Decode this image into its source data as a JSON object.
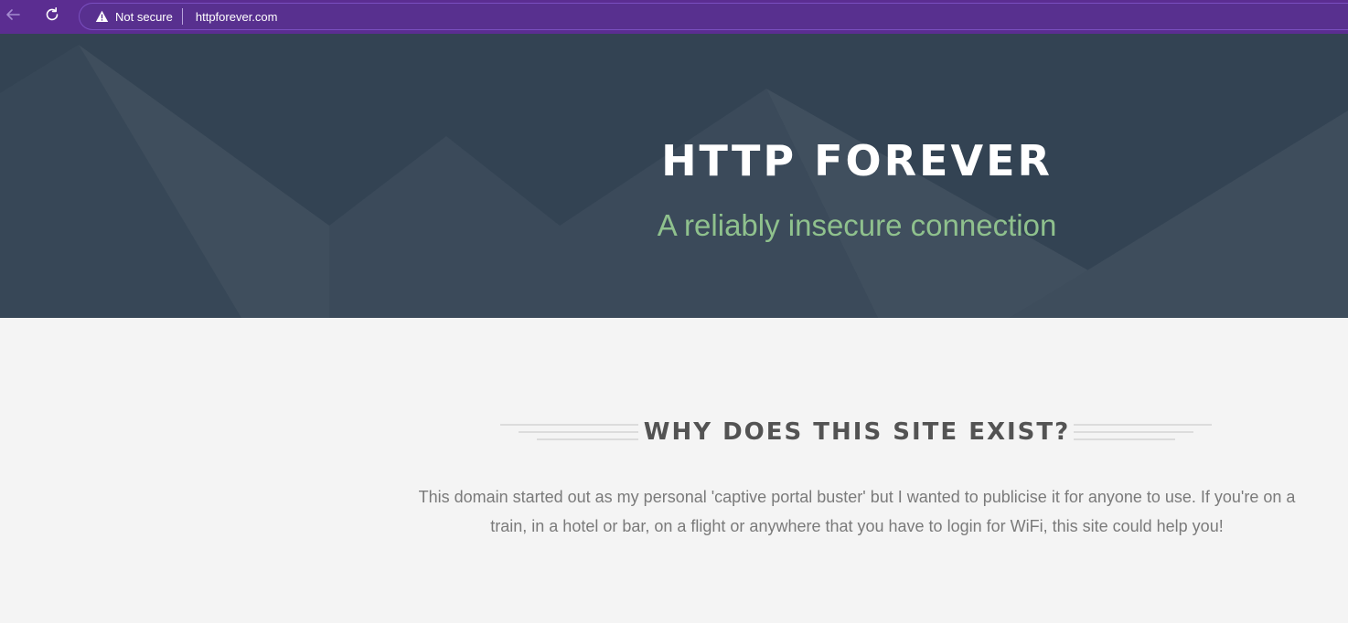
{
  "browser": {
    "security_label": "Not secure",
    "url": "httpforever.com",
    "icons": {
      "back": "arrow-left-icon",
      "reload": "reload-icon",
      "warning": "warning-triangle-icon"
    },
    "colors": {
      "toolbar": "#5b2d91",
      "text": "#ffffff"
    }
  },
  "hero": {
    "title": "HTTP FOREVER",
    "subtitle": "A reliably insecure connection",
    "colors": {
      "background": "#334353",
      "subtitle": "#8fc18d"
    }
  },
  "section": {
    "heading": "WHY DOES THIS SITE EXIST?",
    "body": "This domain started out as my personal 'captive portal buster' but I wanted to publicise it for anyone to use. If you're on a train, in a hotel or bar, on a flight or anywhere that you have to login for WiFi, this site could help you!",
    "colors": {
      "background": "#f4f4f4",
      "heading": "#535353",
      "body": "#7a7a7a"
    }
  }
}
